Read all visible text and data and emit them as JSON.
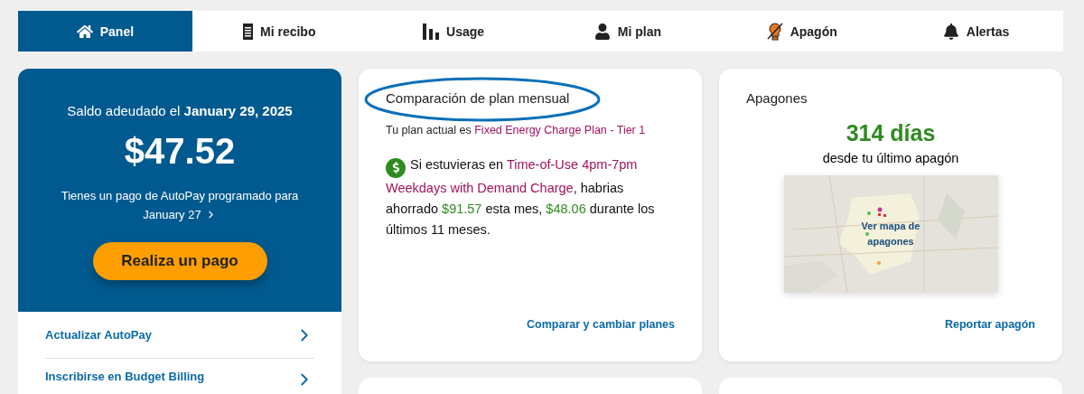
{
  "tabs": [
    {
      "label": "Panel",
      "selected": true
    },
    {
      "label": "Mi recibo",
      "selected": false
    },
    {
      "label": "Usage",
      "selected": false
    },
    {
      "label": "Mi plan",
      "selected": false
    },
    {
      "label": "Apagón",
      "selected": false
    },
    {
      "label": "Alertas",
      "selected": false
    }
  ],
  "balance": {
    "due_label": "Saldo adeudado el",
    "due_date": "January 29, 2025",
    "amount": "$47.52",
    "autopay_text": "Tienes un pago de AutoPay programado para",
    "autopay_date": "January 27",
    "pay_button": "Realiza un pago"
  },
  "account_links": [
    {
      "label": "Actualizar AutoPay"
    },
    {
      "label": "Inscribirse en Budget Billing"
    }
  ],
  "plan_card": {
    "title": "Comparación de plan mensual",
    "highlighted": true,
    "current_plan": [
      {
        "text": "Tu plan actual es ",
        "color": "#222222"
      },
      {
        "text": "Fixed Energy Charge Plan - Tier 1",
        "color": "#a0125e"
      }
    ],
    "savings": [
      {
        "text": "Si estuvieras en ",
        "color": "#111111"
      },
      {
        "text": "Time-of-Use 4pm-7pm Weekdays with Demand Charge",
        "color": "#a0125e"
      },
      {
        "text": ", habrias ahorrado ",
        "color": "#111111"
      },
      {
        "text": "$91.57",
        "color": "#2e8b1f"
      },
      {
        "text": " esta mes, ",
        "color": "#111111"
      },
      {
        "text": "$48.06",
        "color": "#2e8b1f"
      },
      {
        "text": " durante los últimos 11 meses.",
        "color": "#111111"
      }
    ],
    "link": "Comparar y cambiar planes"
  },
  "outage_card": {
    "title": "Apagones",
    "days": "314 días",
    "since": "desde tu último apagón",
    "map_link": "Ver mapa de apagones",
    "link": "Reportar apagón"
  }
}
